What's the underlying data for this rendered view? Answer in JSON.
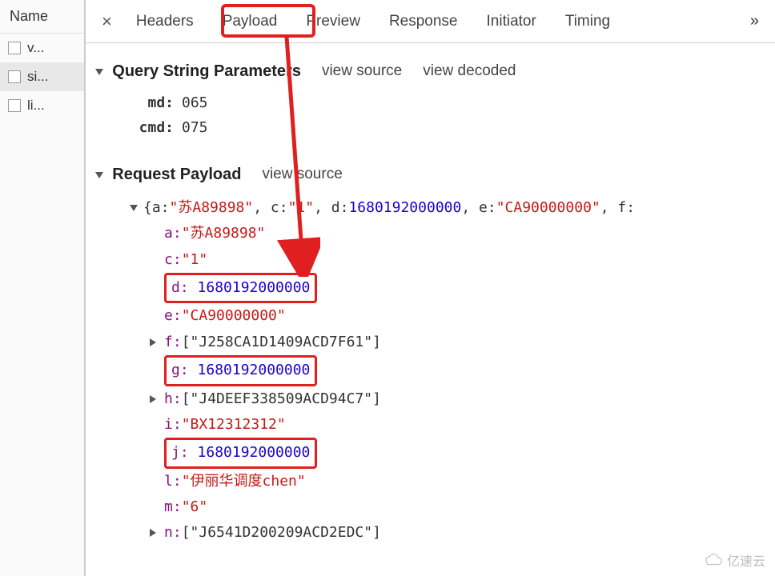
{
  "sidebar": {
    "header": "Name",
    "items": [
      {
        "label": "v..."
      },
      {
        "label": "si..."
      },
      {
        "label": "li..."
      }
    ]
  },
  "tabs": {
    "items": [
      {
        "label": "Headers"
      },
      {
        "label": "Payload"
      },
      {
        "label": "Preview"
      },
      {
        "label": "Response"
      },
      {
        "label": "Initiator"
      },
      {
        "label": "Timing"
      }
    ],
    "active_index": 1
  },
  "query_string": {
    "title": "Query String Parameters",
    "links": {
      "view_source": "view source",
      "view_decoded": "view decoded"
    },
    "params": [
      {
        "key": "md:",
        "value": "065"
      },
      {
        "key": "cmd:",
        "value": "075"
      }
    ]
  },
  "request_payload": {
    "title": "Request Payload",
    "view_source": "view source",
    "summary_prefix": "{a: ",
    "summary_a": "\"苏A89898\"",
    "summary_mid1": ", c: ",
    "summary_c": "\"1\"",
    "summary_mid2": ", d: ",
    "summary_d": "1680192000000",
    "summary_mid3": ", e: ",
    "summary_e": "\"CA90000000\"",
    "summary_tail": ", f:",
    "fields": {
      "a": {
        "key": "a:",
        "value": "\"苏A89898\"",
        "type": "str",
        "expand": "none"
      },
      "c": {
        "key": "c:",
        "value": "\"1\"",
        "type": "str",
        "expand": "none"
      },
      "d": {
        "key": "d:",
        "value": "1680192000000",
        "type": "num",
        "expand": "none",
        "hilite": true
      },
      "e": {
        "key": "e:",
        "value": "\"CA90000000\"",
        "type": "str",
        "expand": "none"
      },
      "f": {
        "key": "f:",
        "value": "[\"J258CA1D1409ACD7F61\"]",
        "type": "plain",
        "expand": "right"
      },
      "g": {
        "key": "g:",
        "value": "1680192000000",
        "type": "num",
        "expand": "none",
        "hilite": true
      },
      "h": {
        "key": "h:",
        "value": "[\"J4DEEF338509ACD94C7\"]",
        "type": "plain",
        "expand": "right"
      },
      "i": {
        "key": "i:",
        "value": "\"BX12312312\"",
        "type": "str",
        "expand": "none"
      },
      "j": {
        "key": "j:",
        "value": "1680192000000",
        "type": "num",
        "expand": "none",
        "hilite": true
      },
      "l": {
        "key": "l:",
        "value": "\"伊丽华调度chen\"",
        "type": "str",
        "expand": "none"
      },
      "m": {
        "key": "m:",
        "value": "\"6\"",
        "type": "str",
        "expand": "none"
      },
      "n": {
        "key": "n:",
        "value": "[\"J6541D200209ACD2EDC\"]",
        "type": "plain",
        "expand": "right"
      }
    }
  },
  "watermark": "亿速云"
}
